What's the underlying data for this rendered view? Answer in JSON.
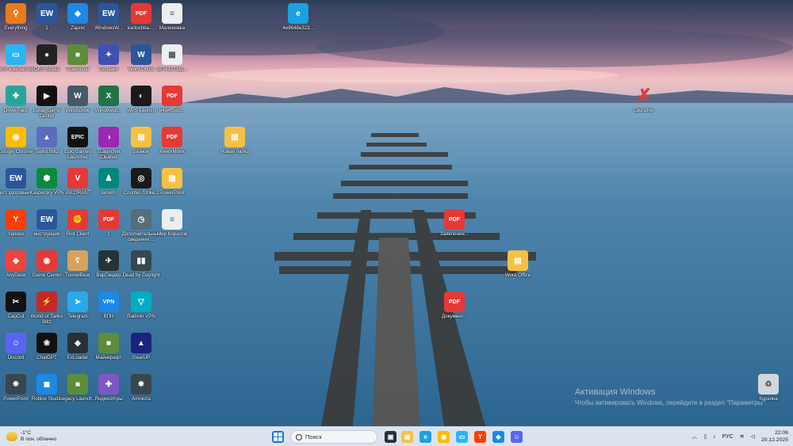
{
  "desktop": {
    "icons": [
      {
        "label": "Everything",
        "color": "#e87b1c",
        "glyph": "⚲"
      },
      {
        "label": "1",
        "color": "#2b579a",
        "glyph": "EW"
      },
      {
        "label": "Zapret",
        "color": "#1e88e5",
        "glyph": "◆"
      },
      {
        "label": "WindowsW...",
        "color": "#2b579a",
        "glyph": "EW"
      },
      {
        "label": "kartochka-...",
        "color": "#e53935",
        "glyph": "PDF"
      },
      {
        "label": "Малиновка",
        "color": "#eceff1",
        "glyph": "≡"
      },
      {
        "label": "4e9648e323...",
        "color": "#1ba1e2",
        "glyph": "e"
      },
      {
        "label": "Этот компьютер",
        "color": "#29b6f6",
        "glyph": "▭"
      },
      {
        "label": "OBS Studio",
        "color": "#222222",
        "glyph": "●"
      },
      {
        "label": "TLauncher",
        "color": "#5d8c3a",
        "glyph": "■"
      },
      {
        "label": "Crystalix",
        "color": "#3f51b5",
        "glyph": "✦"
      },
      {
        "label": "Word Office",
        "color": "#2b579a",
        "glyph": "W"
      },
      {
        "label": "1674137311...",
        "color": "#eceff1",
        "glyph": "▦"
      },
      {
        "label": "DriverPack",
        "color": "#26a69a",
        "glyph": "✚"
      },
      {
        "label": "Lunar Game Center",
        "color": "#111111",
        "glyph": "▶"
      },
      {
        "label": "Windscribe",
        "color": "#455a64",
        "glyph": "W"
      },
      {
        "label": "WindowsE...",
        "color": "#217346",
        "glyph": "X"
      },
      {
        "label": "WPS Launch",
        "color": "#1a1a1a",
        "glyph": "◐"
      },
      {
        "label": "e4d4ff5bc...",
        "color": "#e53935",
        "glyph": "PDF"
      },
      {
        "label": "Launcher",
        "color": "transparent",
        "glyph": "✗"
      },
      {
        "label": "Google Chrome",
        "color": "#fbbc05",
        "glyph": "◉"
      },
      {
        "label": "Tanks Blitz",
        "color": "#5c6bc0",
        "glyph": "▲"
      },
      {
        "label": "Epic Games Launcher",
        "color": "#111111",
        "glyph": "EPIC"
      },
      {
        "label": "TLauncher Cleaner",
        "color": "#9c27b0",
        "glyph": "◑"
      },
      {
        "label": "разное",
        "color": "#f6c142",
        "glyph": "▤"
      },
      {
        "label": "КнигиМоих",
        "color": "#e53935",
        "glyph": "PDF"
      },
      {
        "label": "Новая папка",
        "color": "#f6c142",
        "glyph": "▤"
      },
      {
        "label": "Тест здоровье ...",
        "color": "#2b579a",
        "glyph": "EW"
      },
      {
        "label": "Kaspersky VPN",
        "color": "#0b8a3c",
        "glyph": "⬢"
      },
      {
        "label": "VALORANT",
        "color": "#e53935",
        "glyph": "V"
      },
      {
        "label": "lamern",
        "color": "#00897b",
        "glyph": "♟"
      },
      {
        "label": "Counter-Strike 2",
        "color": "#1a1a1a",
        "glyph": "◎"
      },
      {
        "label": "PowerPoint",
        "color": "#f6c142",
        "glyph": "▤"
      },
      {
        "label": "Yandex",
        "color": "#ff3d00",
        "glyph": "Y"
      },
      {
        "label": "инструкция",
        "color": "#2b579a",
        "glyph": "EW"
      },
      {
        "label": "Riot Client",
        "color": "#e53935",
        "glyph": "✊"
      },
      {
        "label": "1",
        "color": "#e53935",
        "glyph": "PDF"
      },
      {
        "label": "Дополнительные сведения ...",
        "color": "#546e7a",
        "glyph": "◷"
      },
      {
        "label": "Мир Коралов",
        "color": "#eceff1",
        "glyph": "≡"
      },
      {
        "label": "Заявление...",
        "color": "#e53935",
        "glyph": "PDF"
      },
      {
        "label": "AnyDesk",
        "color": "#ef443b",
        "glyph": "◆"
      },
      {
        "label": "Game Center",
        "color": "#e53935",
        "glyph": "◉"
      },
      {
        "label": "TunnelBear",
        "color": "#d8a25e",
        "glyph": "ʕ"
      },
      {
        "label": "ВарГандер",
        "color": "#263238",
        "glyph": "✈"
      },
      {
        "label": "Dead by Daylight",
        "color": "#37474f",
        "glyph": "▮▮"
      },
      {
        "label": "Word Office",
        "color": "#f6c142",
        "glyph": "▤"
      },
      {
        "label": "CapCut",
        "color": "#111111",
        "glyph": "✂"
      },
      {
        "label": "World of Tanks Blitz",
        "color": "#c62828",
        "glyph": "⚡"
      },
      {
        "label": "Telegram",
        "color": "#29a9ea",
        "glyph": "➤"
      },
      {
        "label": "ВПН",
        "color": "#1e88e5",
        "glyph": "VPN"
      },
      {
        "label": "Radmin VPN",
        "color": "#00acc1",
        "glyph": "▽"
      },
      {
        "label": "Документ...",
        "color": "#e53935",
        "glyph": "PDF"
      },
      {
        "label": "Discord",
        "color": "#5865f2",
        "glyph": "☺"
      },
      {
        "label": "ChatGPT",
        "color": "#111111",
        "glyph": "❀"
      },
      {
        "label": "ExLoader",
        "color": "#263238",
        "glyph": "◈"
      },
      {
        "label": "Майнкрафт",
        "color": "#5d8c3a",
        "glyph": "■"
      },
      {
        "label": "GearUP",
        "color": "#1a237e",
        "glyph": "▲"
      },
      {
        "label": "PowerPoint",
        "color": "#37474f",
        "glyph": "✸"
      },
      {
        "label": "Roblox Studio",
        "color": "#1e88e5",
        "glyph": "◼"
      },
      {
        "label": "Legacy Launch...",
        "color": "#5d8c3a",
        "glyph": "■"
      },
      {
        "label": "ЯндексИгры",
        "color": "#7e57c2",
        "glyph": "✚"
      },
      {
        "label": "Amnezia",
        "color": "#37474f",
        "glyph": "✸"
      },
      {
        "label": "Корзина",
        "color": "#cfd8dc",
        "glyph": "♻"
      }
    ]
  },
  "activation": {
    "title": "Активация Windows",
    "subtitle": "Чтобы активировать Windows, перейдите в раздел \"Параметры\"."
  },
  "taskbar": {
    "weather_temp": "-1°C",
    "weather_desc": "В осн. облачно",
    "search_placeholder": "Поиск",
    "language": "РУС",
    "time": "22:06",
    "date": "20.12.2025"
  }
}
